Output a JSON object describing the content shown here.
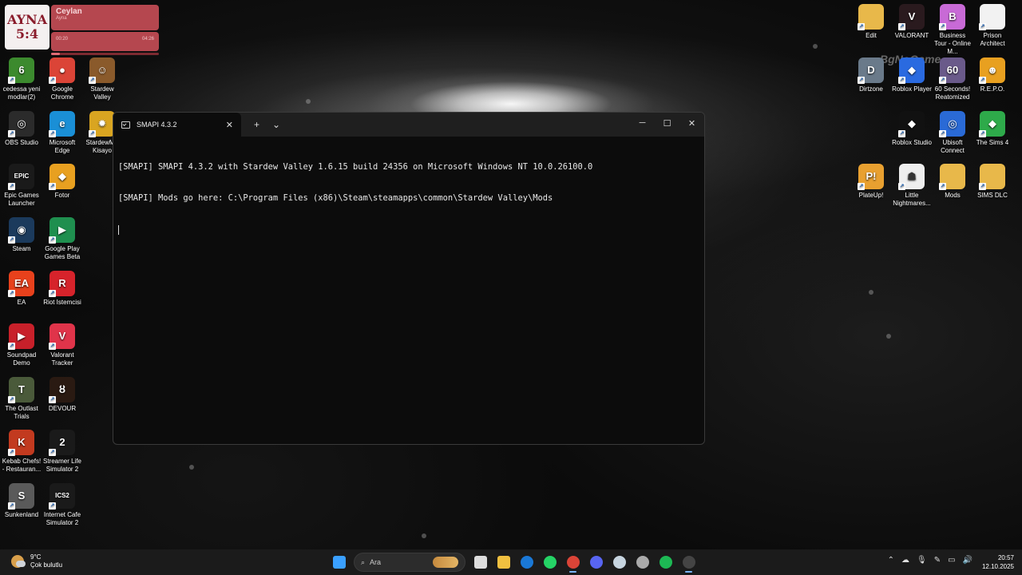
{
  "music_widget": {
    "art_line1": "AYNA",
    "art_line2": "5:4",
    "title": "Ceylan",
    "artist": "Ayna",
    "elapsed": "00:20",
    "duration": "04:26",
    "progress": 0.08
  },
  "desktop_icons_left": [
    {
      "label": "cedessa yeni modlar(2)",
      "icon": "folder-thumbnail-icon",
      "color": "#3c8a2e",
      "glyph": "6"
    },
    {
      "label": "Google Chrome",
      "icon": "chrome-icon",
      "color": "#db4437",
      "glyph": "●"
    },
    {
      "label": "Stardew Valley",
      "icon": "stardew-valley-icon",
      "color": "#8a5a2b",
      "glyph": "☺"
    },
    {
      "label": "OBS Studio",
      "icon": "obs-studio-icon",
      "color": "#2b2b2b",
      "glyph": "◎"
    },
    {
      "label": "Microsoft Edge",
      "icon": "edge-icon",
      "color": "#1a8fd6",
      "glyph": "e"
    },
    {
      "label": "StardewM - Kisayo",
      "icon": "smapi-icon",
      "color": "#d9a521",
      "glyph": "✹"
    },
    {
      "label": "Epic Games Launcher",
      "icon": "epic-games-icon",
      "color": "#1a1a1a",
      "glyph": "EPIC"
    },
    {
      "label": "Fotor",
      "icon": "fotor-icon",
      "color": "#e8a020",
      "glyph": "◆"
    },
    {
      "label": "Steam",
      "icon": "steam-icon",
      "color": "#1b3a5c",
      "glyph": "◉"
    },
    {
      "label": "Google Play Games Beta",
      "icon": "google-play-games-icon",
      "color": "#1f8f4f",
      "glyph": "▶"
    },
    {
      "label": "EA",
      "icon": "ea-icon",
      "color": "#e8411c",
      "glyph": "EA"
    },
    {
      "label": "Riot Istemcisi",
      "icon": "riot-client-icon",
      "color": "#d6232b",
      "glyph": "R"
    },
    {
      "label": "Soundpad Demo",
      "icon": "soundpad-icon",
      "color": "#c8202a",
      "glyph": "▶"
    },
    {
      "label": "Valorant Tracker",
      "icon": "valorant-tracker-icon",
      "color": "#e0344a",
      "glyph": "V"
    },
    {
      "label": "The Outlast Trials",
      "icon": "outlast-trials-icon",
      "color": "#4a5a3a",
      "glyph": "T"
    },
    {
      "label": "DEVOUR",
      "icon": "devour-icon",
      "color": "#2a1a12",
      "glyph": "ȣ"
    },
    {
      "label": "Kebab Chefs! - Restauran...",
      "icon": "kebab-chefs-icon",
      "color": "#c23a1f",
      "glyph": "K"
    },
    {
      "label": "Streamer Life Simulator 2",
      "icon": "streamer-life-icon",
      "color": "#1a1a1a",
      "glyph": "2"
    },
    {
      "label": "Sunkenland",
      "icon": "sunkenland-icon",
      "color": "#5a5a5a",
      "glyph": "S"
    },
    {
      "label": "Internet Cafe Simulator 2",
      "icon": "internet-cafe-icon",
      "color": "#1a1a1a",
      "glyph": "ICS2"
    }
  ],
  "desktop_icons_right": [
    {
      "label": "Edit",
      "icon": "folder-icon",
      "color": "#e8b84a",
      "glyph": ""
    },
    {
      "label": "VALORANT",
      "icon": "valorant-icon",
      "color": "#2a1a1e",
      "glyph": "V"
    },
    {
      "label": "Business Tour - Online M...",
      "icon": "business-tour-icon",
      "color": "#c86ad6",
      "glyph": "B"
    },
    {
      "label": "Prison Architect",
      "icon": "file-icon",
      "color": "#f2f2f2",
      "glyph": ""
    },
    {
      "label": "Dirtzone",
      "icon": "dirtzone-icon",
      "color": "#6a7a8a",
      "glyph": "D"
    },
    {
      "label": "Roblox Player",
      "icon": "roblox-player-icon",
      "color": "#2a6ae0",
      "glyph": "◆"
    },
    {
      "label": "60 Seconds! Reatomized",
      "icon": "sixty-seconds-icon",
      "color": "#6a5a8a",
      "glyph": "60"
    },
    {
      "label": "R.E.P.O.",
      "icon": "repo-icon",
      "color": "#e8a020",
      "glyph": "☻"
    },
    {
      "label": "Roblox Studio",
      "icon": "roblox-studio-icon",
      "color": "#111111",
      "glyph": "◆"
    },
    {
      "label": "Ubisoft Connect",
      "icon": "ubisoft-connect-icon",
      "color": "#2a6ad6",
      "glyph": "◎"
    },
    {
      "label": "The Sims 4",
      "icon": "sims4-icon",
      "color": "#2eaa4a",
      "glyph": "◆"
    },
    {
      "label": "PlateUp!",
      "icon": "plateup-icon",
      "color": "#e8a030",
      "glyph": "P!"
    },
    {
      "label": "Little Nightmares...",
      "icon": "little-nightmares-icon",
      "color": "#eeeeee",
      "glyph": "☗"
    },
    {
      "label": "Mods",
      "icon": "folder-icon",
      "color": "#e8b84a",
      "glyph": ""
    },
    {
      "label": "SIMS DLC",
      "icon": "folder-icon",
      "color": "#e8b84a",
      "glyph": ""
    }
  ],
  "terminal": {
    "tab_title": "SMAPI 4.3.2",
    "new_tab": "+",
    "dropdown": "⌄",
    "lines": [
      "[SMAPI] SMAPI 4.3.2 with Stardew Valley 1.6.15 build 24356 on Microsoft Windows NT 10.0.26100.0",
      "[SMAPI] Mods go here: C:\\Program Files (x86)\\Steam\\steamapps\\common\\Stardew Valley\\Mods"
    ]
  },
  "watermark": "BgNoGame",
  "taskbar": {
    "weather_temp": "9°C",
    "weather_desc": "Çok bulutlu",
    "search_placeholder": "Ara",
    "apps": [
      {
        "name": "start-button",
        "color": "#3aa0ff"
      },
      {
        "name": "task-view-icon",
        "color": "#dddddd"
      },
      {
        "name": "file-explorer-icon",
        "color": "#f0c040"
      },
      {
        "name": "outlook-icon",
        "color": "#1a78d6"
      },
      {
        "name": "whatsapp-icon",
        "color": "#25d366"
      },
      {
        "name": "chrome-icon",
        "color": "#db4437"
      },
      {
        "name": "discord-icon",
        "color": "#5865f2"
      },
      {
        "name": "steam-icon",
        "color": "#c7d5e0"
      },
      {
        "name": "steam-helper-icon",
        "color": "#aaaaaa"
      },
      {
        "name": "spotify-icon",
        "color": "#1db954"
      },
      {
        "name": "terminal-icon",
        "color": "#444444"
      }
    ],
    "time": "20:57",
    "date": "12.10.2025"
  }
}
